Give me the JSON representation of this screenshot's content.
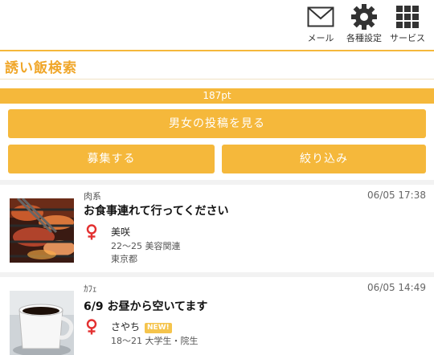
{
  "header": {
    "icons": [
      {
        "label": "メール",
        "icon": "mail-icon"
      },
      {
        "label": "各種設定",
        "icon": "gear-icon"
      },
      {
        "label": "サービス",
        "icon": "grid-icon"
      }
    ]
  },
  "page": {
    "title": "誘い飯検索"
  },
  "points": "187pt",
  "buttons": {
    "view_posts": "男女の投稿を見る",
    "recruit": "募集する",
    "filter": "絞り込み"
  },
  "posts": [
    {
      "category": "肉系",
      "time": "06/05 17:38",
      "title": "お食事連れて行ってください",
      "name": "美咲",
      "profile": "22〜25 美容関連",
      "location": "東京都",
      "new_badge": ""
    },
    {
      "category": "ｶﾌｪ",
      "time": "06/05 14:49",
      "title": "6/9 お昼から空いてます",
      "name": "さやち",
      "profile": "18〜21 大学生・院生",
      "location": "",
      "new_badge": "NEW!"
    }
  ],
  "colors": {
    "accent": "#f5b83b",
    "title": "#f0a629",
    "female_symbol": "#e33030"
  }
}
